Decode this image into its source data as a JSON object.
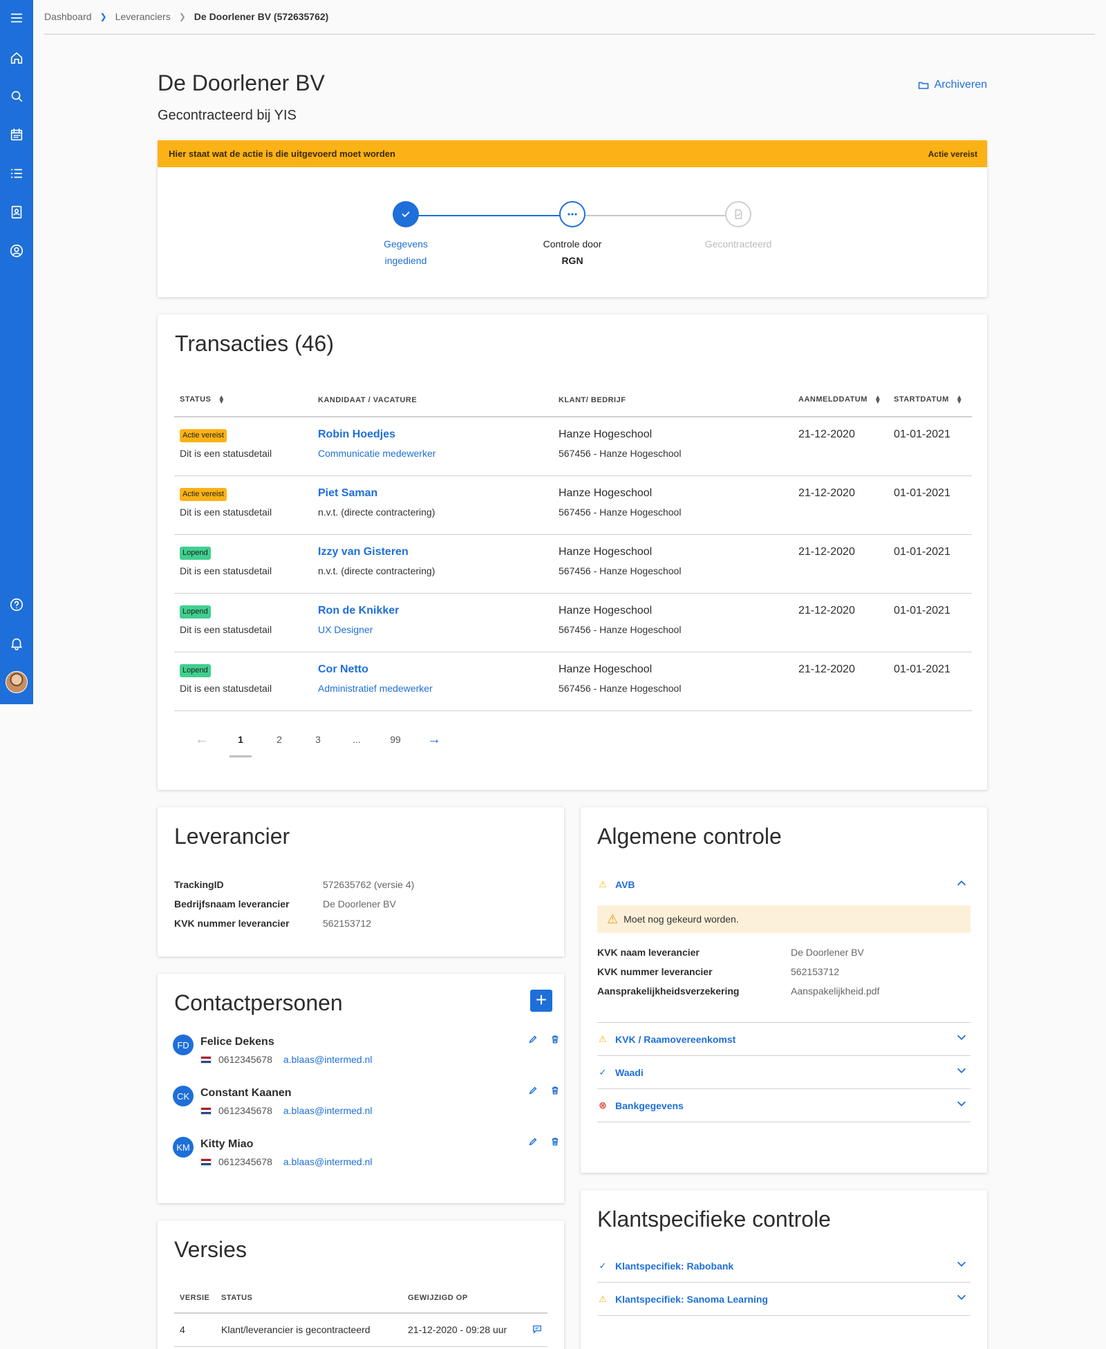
{
  "nav": {
    "icons": [
      "menu-icon",
      "home-icon",
      "search-icon",
      "calendar-icon",
      "list-icon",
      "contacts-icon",
      "account-icon",
      "help-icon",
      "bell-icon"
    ]
  },
  "breadcrumb": {
    "items": [
      "Dashboard",
      "Leveranciers"
    ],
    "current": "De Doorlener BV (572635762)"
  },
  "header": {
    "title": "De Doorlener BV",
    "subtitle": "Gecontracteerd bij YIS",
    "archive_label": "Archiveren"
  },
  "status_card": {
    "alert_text": "Hier staat wat de actie is die uitgevoerd moet worden",
    "alert_tag": "Actie vereist",
    "steps": [
      {
        "line1": "Gegevens",
        "line2": "ingediend",
        "state": "done"
      },
      {
        "line1": "Controle door",
        "line2": "RGN",
        "state": "current"
      },
      {
        "line1": "Gecontracteerd",
        "line2": "",
        "state": "pending"
      }
    ]
  },
  "transactions": {
    "title": "Transacties (46)",
    "columns": [
      "STATUS",
      "KANDIDAAT / VACATURE",
      "KLANT/ BEDRIJF",
      "AANMELDDATUM",
      "STARTDATUM"
    ],
    "rows": [
      {
        "badge": "Actie vereist",
        "badge_type": "warn",
        "status_detail": "Dit is een statusdetail",
        "candidate": "Robin Hoedjes",
        "vacancy": "Communicatie medewerker",
        "vacancy_link": true,
        "company": "Hanze Hogeschool",
        "company_sub": "567456 - Hanze Hogeschool",
        "signup": "21-12-2020",
        "start": "01-01-2021"
      },
      {
        "badge": "Actie vereist",
        "badge_type": "warn",
        "status_detail": "Dit is een statusdetail",
        "candidate": "Piet Saman",
        "vacancy": "n.v.t. (directe contractering)",
        "vacancy_link": false,
        "company": "Hanze Hogeschool",
        "company_sub": "567456 - Hanze Hogeschool",
        "signup": "21-12-2020",
        "start": "01-01-2021"
      },
      {
        "badge": "Lopend",
        "badge_type": "ok",
        "status_detail": "Dit is een statusdetail",
        "candidate": "Izzy van Gisteren",
        "vacancy": "n.v.t. (directe contractering)",
        "vacancy_link": false,
        "company": "Hanze Hogeschool",
        "company_sub": "567456 - Hanze Hogeschool",
        "signup": "21-12-2020",
        "start": "01-01-2021"
      },
      {
        "badge": "Lopend",
        "badge_type": "ok",
        "status_detail": "Dit is een statusdetail",
        "candidate": "Ron de Knikker",
        "vacancy": "UX Designer",
        "vacancy_link": true,
        "company": "Hanze Hogeschool",
        "company_sub": "567456 - Hanze Hogeschool",
        "signup": "21-12-2020",
        "start": "01-01-2021"
      },
      {
        "badge": "Lopend",
        "badge_type": "ok",
        "status_detail": "Dit is een statusdetail",
        "candidate": "Cor Netto",
        "vacancy": "Administratief medewerker",
        "vacancy_link": true,
        "company": "Hanze Hogeschool",
        "company_sub": "567456 - Hanze Hogeschool",
        "signup": "21-12-2020",
        "start": "01-01-2021"
      }
    ],
    "pagination": {
      "pages": [
        "1",
        "2",
        "3",
        "...",
        "99"
      ],
      "current": "1",
      "prev": "←",
      "next": "→"
    }
  },
  "supplier": {
    "title": "Leverancier",
    "fields": [
      {
        "label": "TrackingID",
        "value": "572635762 (versie 4)"
      },
      {
        "label": "Bedrijfsnaam leverancier",
        "value": "De Doorlener BV"
      },
      {
        "label": "KVK nummer leverancier",
        "value": "562153712"
      }
    ]
  },
  "contacts": {
    "title": "Contactpersonen",
    "add_label": "+",
    "people": [
      {
        "initials": "FD",
        "name": "Felice Dekens",
        "phone": "0612345678",
        "email": "a.blaas@intermed.nl"
      },
      {
        "initials": "CK",
        "name": "Constant Kaanen",
        "phone": "0612345678",
        "email": "a.blaas@intermed.nl"
      },
      {
        "initials": "KM",
        "name": "Kitty Miao",
        "phone": "0612345678",
        "email": "a.blaas@intermed.nl"
      }
    ]
  },
  "versions": {
    "title": "Versies",
    "columns": [
      "VERSIE",
      "STATUS",
      "GEWIJZIGD OP"
    ],
    "rows": [
      {
        "version": "4",
        "status": "Klant/leverancier is gecontracteerd",
        "modified": "21-12-2020 - 09:28 uur"
      }
    ]
  },
  "general_check": {
    "title": "Algemene controle",
    "open_item": {
      "label": "AVB",
      "status": "warning",
      "warning": "Moet nog gekeurd worden.",
      "fields": [
        {
          "label": "KVK naam leverancier",
          "value": "De Doorlener BV",
          "link": false
        },
        {
          "label": "KVK nummer leverancier",
          "value": "562153712",
          "link": false
        },
        {
          "label": "Aansprakelijkheidsverzekering",
          "value": "Aanspakelijkheid.pdf",
          "link": true
        }
      ]
    },
    "items": [
      {
        "label": "KVK / Raamovereenkomst",
        "status": "warning"
      },
      {
        "label": "Waadi",
        "status": "ok"
      },
      {
        "label": "Bankgegevens",
        "status": "error"
      }
    ]
  },
  "client_check": {
    "title": "Klantspecifieke controle",
    "items": [
      {
        "label": "Klantspecifiek: Rabobank",
        "status": "ok"
      },
      {
        "label": "Klantspecifiek: Sanoma Learning",
        "status": "warning"
      }
    ]
  },
  "colors": {
    "primary": "#1e6fd9",
    "warning": "#fbb216",
    "success": "#3fcf8e",
    "error": "#e0413a"
  }
}
